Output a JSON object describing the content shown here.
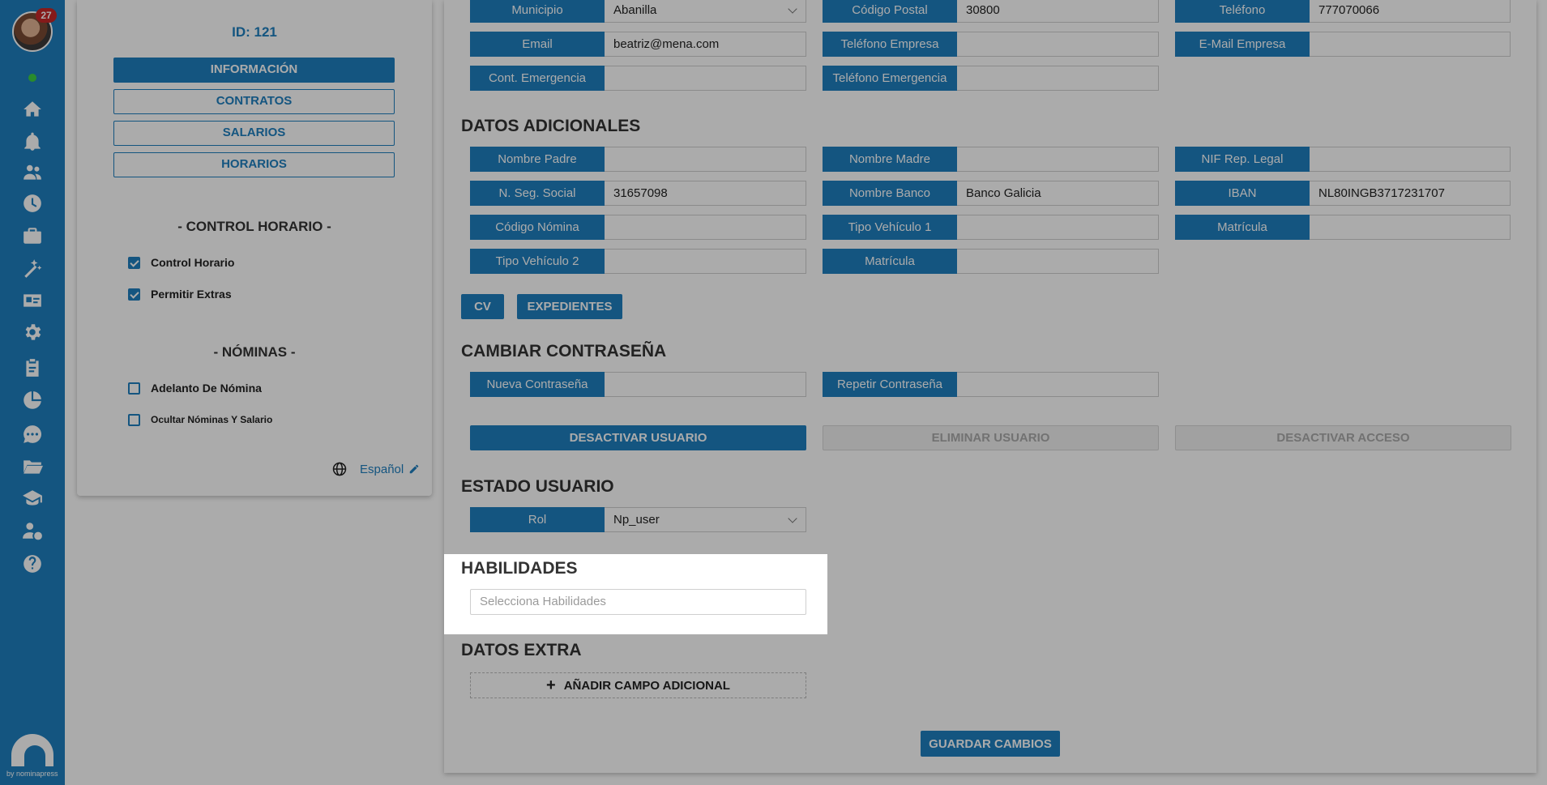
{
  "sidebar": {
    "badge_count": "27",
    "icons": [
      "home-icon",
      "bell-icon",
      "users-icon",
      "clock-icon",
      "briefcase-icon",
      "magic-icon",
      "id-card-icon",
      "gear-icon",
      "clipboard-icon",
      "pie-chart-icon",
      "chat-icon",
      "folder-icon",
      "graduation-icon",
      "user-money-icon",
      "help-icon"
    ],
    "logo_text": "by nominapress"
  },
  "left": {
    "id_label": "ID: 121",
    "tabs": [
      "INFORMACIÓN",
      "CONTRATOS",
      "SALARIOS",
      "HORARIOS"
    ],
    "control_head": "- CONTROL HORARIO -",
    "control_items": [
      {
        "label": "Control Horario",
        "checked": true
      },
      {
        "label": "Permitir Extras",
        "checked": true
      }
    ],
    "nominas_head": "- NÓMINAS -",
    "nominas_items": [
      {
        "label": "Adelanto De Nómina",
        "checked": false
      },
      {
        "label": "Ocultar Nóminas Y Salario",
        "checked": false
      }
    ],
    "language": "Español"
  },
  "contact": {
    "rows": [
      [
        {
          "label": "Municipio",
          "value": "Abanilla",
          "dropdown": true
        },
        {
          "label": "Código Postal",
          "value": "30800"
        },
        {
          "label": "Teléfono",
          "value": "777070066"
        }
      ],
      [
        {
          "label": "Email",
          "value": "beatriz@mena.com"
        },
        {
          "label": "Teléfono Empresa",
          "value": ""
        },
        {
          "label": "E-Mail Empresa",
          "value": ""
        }
      ],
      [
        {
          "label": "Cont. Emergencia",
          "value": ""
        },
        {
          "label": "Teléfono Emergencia",
          "value": ""
        }
      ]
    ]
  },
  "additional": {
    "title": "DATOS ADICIONALES",
    "rows": [
      [
        {
          "label": "Nombre Padre",
          "value": ""
        },
        {
          "label": "Nombre Madre",
          "value": ""
        },
        {
          "label": "NIF Rep. Legal",
          "value": ""
        }
      ],
      [
        {
          "label": "N. Seg. Social",
          "value": "31657098"
        },
        {
          "label": "Nombre Banco",
          "value": "Banco Galicia"
        },
        {
          "label": "IBAN",
          "value": "NL80INGB3717231707"
        }
      ],
      [
        {
          "label": "Código Nómina",
          "value": ""
        },
        {
          "label": "Tipo Vehículo 1",
          "value": ""
        },
        {
          "label": "Matrícula",
          "value": ""
        }
      ],
      [
        {
          "label": "Tipo Vehículo 2",
          "value": ""
        },
        {
          "label": "Matrícula",
          "value": ""
        }
      ]
    ],
    "cv_label": "CV",
    "expedientes_label": "EXPEDIENTES"
  },
  "password": {
    "title": "CAMBIAR CONTRASEÑA",
    "new_label": "Nueva Contraseña",
    "repeat_label": "Repetir Contraseña"
  },
  "actions": {
    "deactivate_user": "DESACTIVAR USUARIO",
    "delete_user": "ELIMINAR USUARIO",
    "deactivate_access": "DESACTIVAR ACCESO"
  },
  "status": {
    "title": "ESTADO USUARIO",
    "role_label": "Rol",
    "role_value": "Np_user"
  },
  "skills": {
    "title": "HABILIDADES",
    "placeholder": "Selecciona Habilidades"
  },
  "extra": {
    "title": "DATOS EXTRA",
    "add_label": "AÑADIR CAMPO ADICIONAL"
  },
  "save_label": "GUARDAR CAMBIOS",
  "colors": {
    "primary": "#1f7fbf",
    "badge": "#c62828",
    "online": "#3ecf43"
  }
}
